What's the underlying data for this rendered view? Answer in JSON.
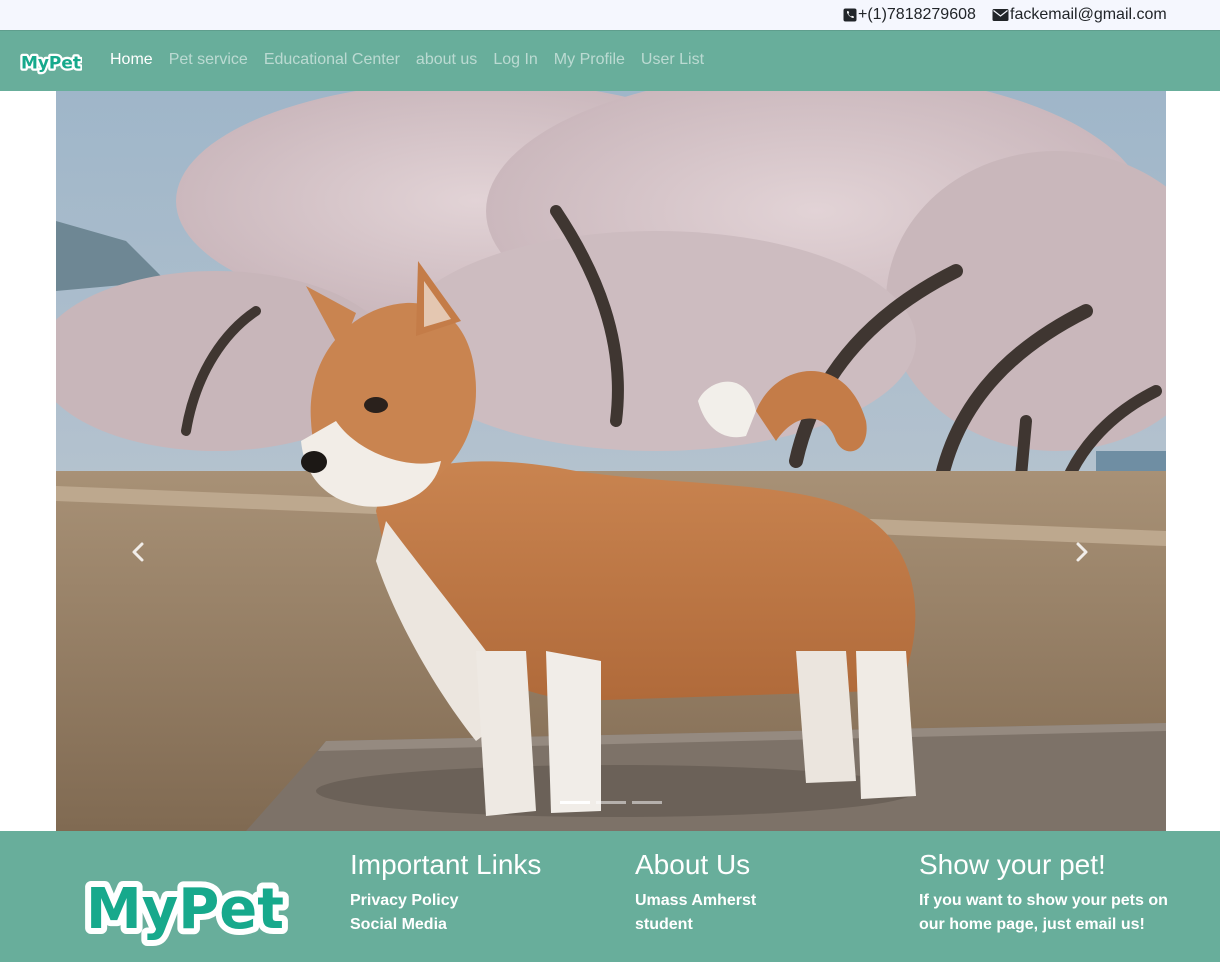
{
  "topbar": {
    "phone": "+(1)7818279608",
    "email": "fackemail@gmail.com"
  },
  "navbar": {
    "brand": "MyPet",
    "links": [
      {
        "label": "Home",
        "active": true
      },
      {
        "label": "Pet service"
      },
      {
        "label": "Educational Center"
      },
      {
        "label": "about us"
      },
      {
        "label": "Log In"
      },
      {
        "label": "My Profile"
      },
      {
        "label": "User List"
      }
    ]
  },
  "carousel": {
    "slides": 3,
    "active_slide": 1
  },
  "footer": {
    "logo": "MyPet",
    "links": {
      "title": "Important Links",
      "items": [
        "Privacy Policy",
        "Social Media"
      ]
    },
    "about": {
      "title": "About Us",
      "line1": "Umass Amherst",
      "line2": "student"
    },
    "show": {
      "title": "Show your pet!",
      "line1": "If you want to show your pets on",
      "line2": "our home page, just email us!"
    }
  },
  "colors": {
    "accent": "#68ae9b",
    "topbar_bg": "#f5f7fe",
    "logo_teal": "#17a98c"
  }
}
